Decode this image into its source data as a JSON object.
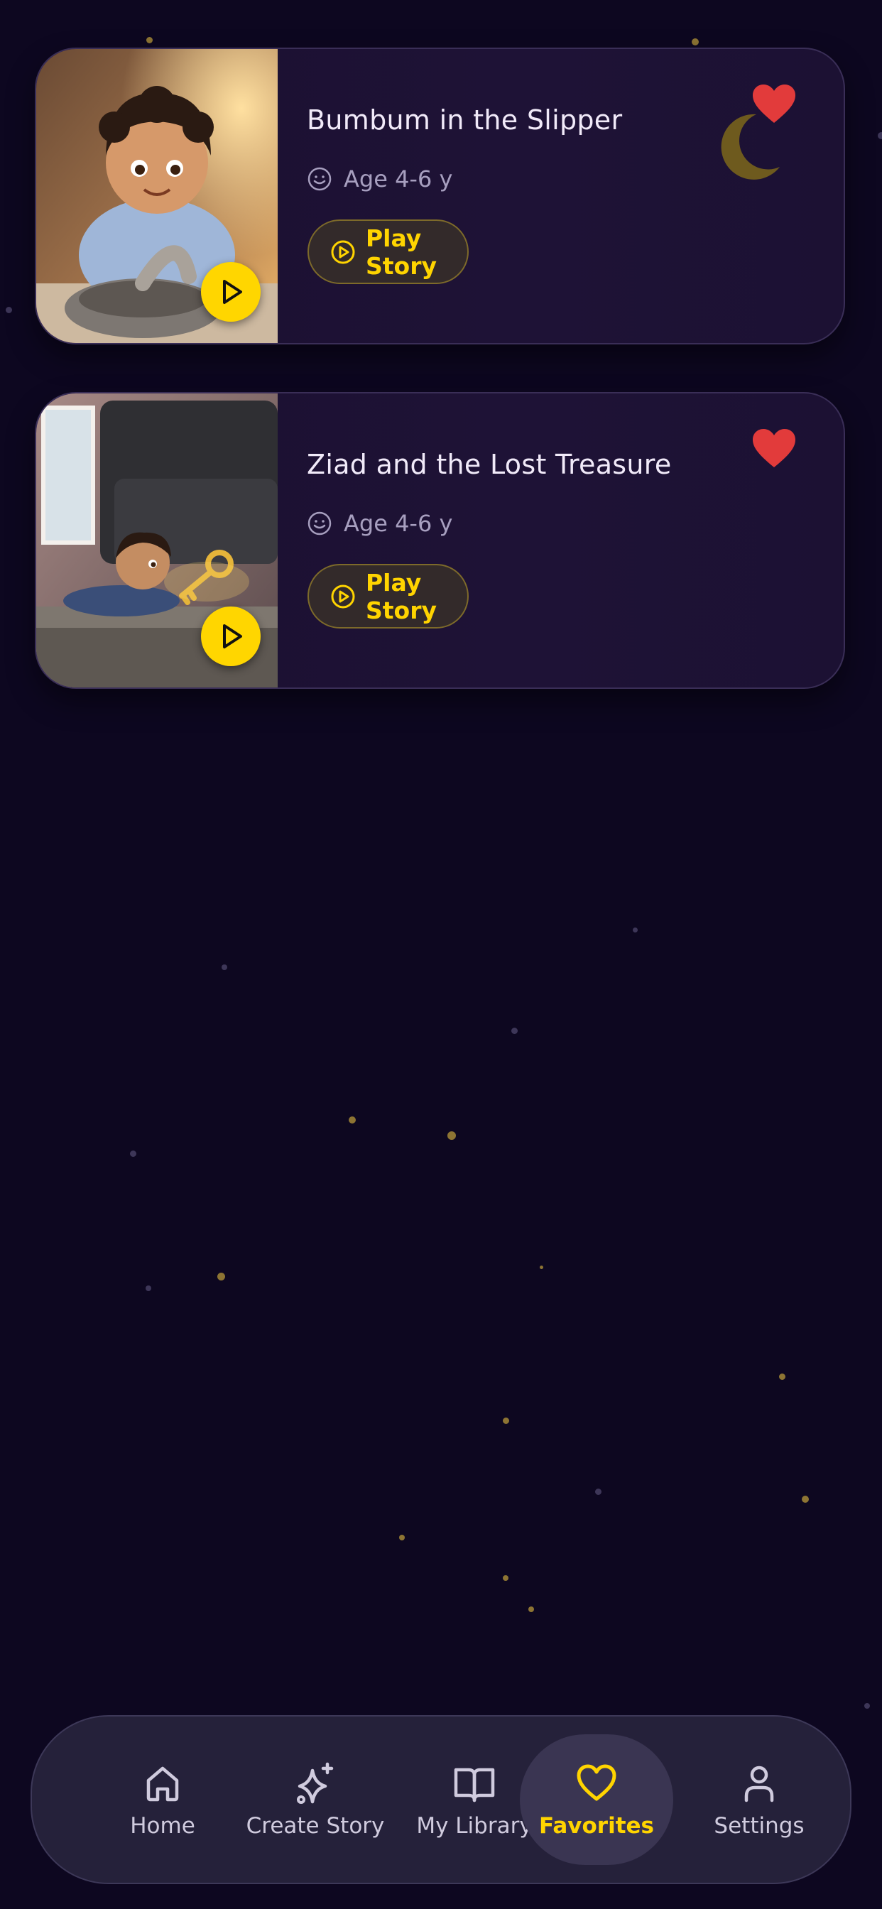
{
  "stories": [
    {
      "title": "Bumbum in the Slipper",
      "age": "Age 4-6 y",
      "play_label": "Play Story",
      "favorited": true
    },
    {
      "title": "Ziad and the Lost Treasure",
      "age": "Age 4-6 y",
      "play_label": "Play Story",
      "favorited": true
    }
  ],
  "nav": {
    "items": [
      {
        "label": "Home",
        "icon": "home-icon"
      },
      {
        "label": "Create Story",
        "icon": "sparkle-icon"
      },
      {
        "label": "My Library",
        "icon": "book-icon"
      },
      {
        "label": "Favorites",
        "icon": "heart-icon"
      },
      {
        "label": "Settings",
        "icon": "user-icon"
      }
    ],
    "active": "Favorites"
  },
  "colors": {
    "background": "#0d0720",
    "accent": "#ffd400",
    "heart": "#e23b3b",
    "card": "#1e1236"
  }
}
